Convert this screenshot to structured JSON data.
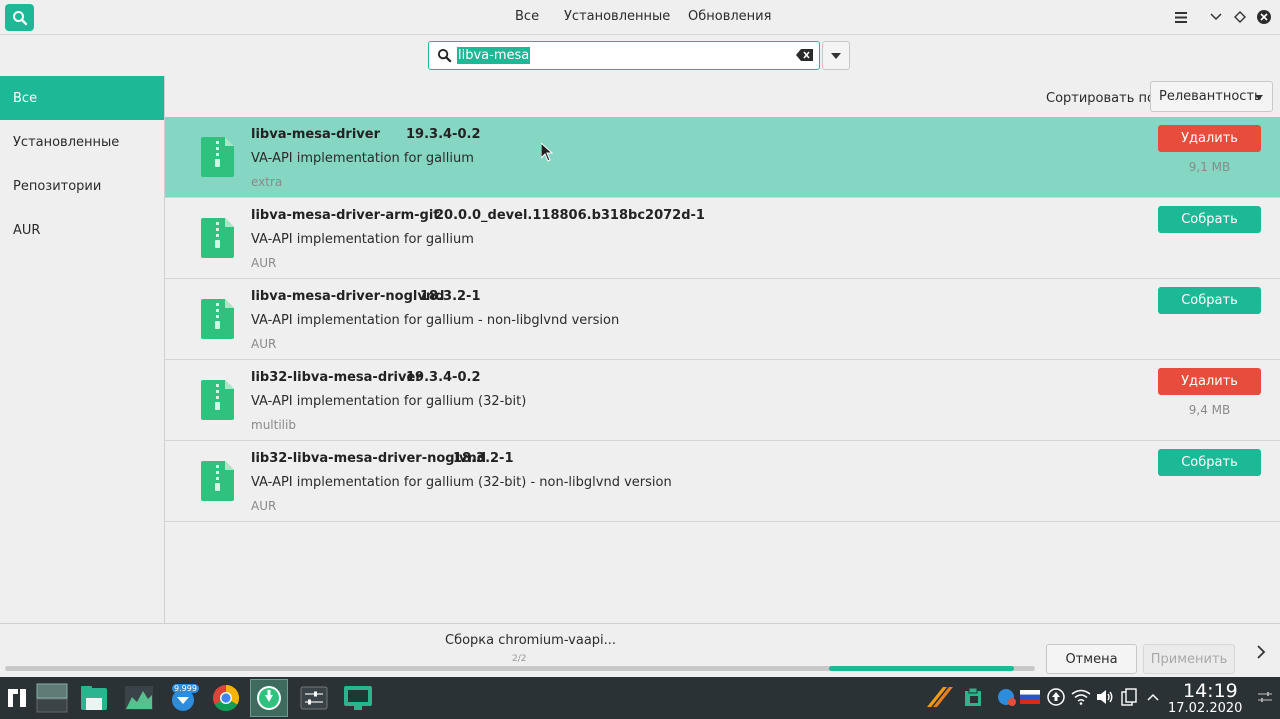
{
  "header": {
    "tabs": [
      {
        "label": "Все"
      },
      {
        "label": "Установленные"
      },
      {
        "label": "Обновления"
      }
    ]
  },
  "search": {
    "value": "libva-mesa"
  },
  "sidebar": {
    "items": [
      {
        "label": "Все",
        "active": true
      },
      {
        "label": "Установленные"
      },
      {
        "label": "Репозитории"
      },
      {
        "label": "AUR"
      }
    ]
  },
  "sort": {
    "label": "Сортировать по",
    "selected": "Релевантность"
  },
  "packages": [
    {
      "name": "libva-mesa-driver",
      "version": "19.3.4-0.2",
      "description": "VA-API implementation for gallium",
      "repo": "extra",
      "action": "Удалить",
      "size": "9,1 MB",
      "selected": true
    },
    {
      "name": "libva-mesa-driver-arm-git",
      "version": "20.0.0_devel.118806.b318bc2072d-1",
      "description": "VA-API implementation for gallium",
      "repo": "AUR",
      "action": "Собрать",
      "size": ""
    },
    {
      "name": "libva-mesa-driver-noglvnd",
      "version": "18.3.2-1",
      "description": "VA-API implementation for gallium - non-libglvnd version",
      "repo": "AUR",
      "action": "Собрать",
      "size": ""
    },
    {
      "name": "lib32-libva-mesa-driver",
      "version": "19.3.4-0.2",
      "description": "VA-API implementation for gallium (32-bit)",
      "repo": "multilib",
      "action": "Удалить",
      "size": "9,4 MB"
    },
    {
      "name": "lib32-libva-mesa-driver-noglvnd",
      "version": "18.3.2-1",
      "description": "VA-API implementation for gallium (32-bit) - non-libglvnd version",
      "repo": "AUR",
      "action": "Собрать",
      "size": ""
    }
  ],
  "footer": {
    "task_text": "Сборка chromium-vaapi...",
    "task_count": "2/2",
    "progress": 0.8,
    "cancel_label": "Отмена",
    "apply_label": "Применить"
  },
  "taskbar": {
    "mail_badge": "9.999",
    "time": "14:19",
    "date": "17.02.2020"
  },
  "colors": {
    "accent": "#1db896",
    "selected_row": "#86d6c4",
    "remove": "#e74c3c"
  }
}
